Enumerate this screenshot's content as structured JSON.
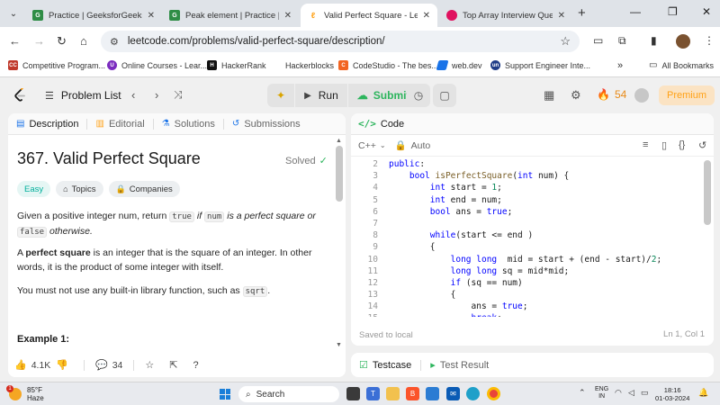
{
  "browser": {
    "tabs": [
      {
        "title": "Practice | GeeksforGeeks | A",
        "favicon": "gfg-icon",
        "color": "#2f8d46"
      },
      {
        "title": "Peak element | Practice | Ge",
        "favicon": "gfg-icon",
        "color": "#2f8d46"
      },
      {
        "title": "Valid Perfect Square - LeetC",
        "favicon": "leetcode-icon",
        "color": "#ffa116"
      },
      {
        "title": "Top Array Interview Questio",
        "favicon": "scaler-icon",
        "color": "#e0115f"
      }
    ],
    "url": "leetcode.com/problems/valid-perfect-square/description/",
    "bookmarks": [
      {
        "label": "Competitive Program...",
        "color": "#c0392b",
        "glyph": "CC"
      },
      {
        "label": "Online Courses - Lear...",
        "color": "#7b2cbf",
        "glyph": "U"
      },
      {
        "label": "HackerRank",
        "color": "#111111",
        "glyph": "H"
      },
      {
        "label": "Hackerblocks",
        "color": "#ffffff",
        "glyph": ""
      },
      {
        "label": "CodeStudio - The bes...",
        "color": "#f26522",
        "glyph": "C"
      },
      {
        "label": "web.dev",
        "color": "#1a73e8",
        "glyph": ""
      },
      {
        "label": "Support Engineer Inte...",
        "color": "#1f3c88",
        "glyph": "un"
      }
    ],
    "all_bookmarks": "All Bookmarks"
  },
  "header": {
    "problem_list": "Problem List",
    "run": "Run",
    "submit": "Submit",
    "streak": "54",
    "premium": "Premium"
  },
  "left": {
    "tabs": [
      "Description",
      "Editorial",
      "Solutions",
      "Submissions"
    ],
    "title": "367. Valid Perfect Square",
    "status": "Solved",
    "chips": [
      "Easy",
      "Topics",
      "Companies"
    ],
    "p1": {
      "a": "Given a positive integer num, return ",
      "c1": "true",
      "b": " if ",
      "c2": "num",
      "d": " is a perfect square or ",
      "c3": "false",
      "e": " otherwise."
    },
    "p2": {
      "bold": "perfect square",
      "a": "A ",
      "b": " is an integer that is the square of an integer. In other words, it is the product of some integer with itself."
    },
    "p3": {
      "a": "You must not use any built-in library function, such as ",
      "code": "sqrt",
      "b": "."
    },
    "example": "Example 1:",
    "likes": "4.1K",
    "comments": "34"
  },
  "code": {
    "title": "Code",
    "language": "C++",
    "auto": "Auto",
    "lines": [
      {
        "n": "2",
        "t": "public:"
      },
      {
        "n": "3",
        "t": "    bool isPerfectSquare(int num) {"
      },
      {
        "n": "4",
        "t": "        int start = 1;"
      },
      {
        "n": "5",
        "t": "        int end = num;"
      },
      {
        "n": "6",
        "t": "        bool ans = true;"
      },
      {
        "n": "7",
        "t": ""
      },
      {
        "n": "8",
        "t": "        while(start <= end )"
      },
      {
        "n": "9",
        "t": "        {"
      },
      {
        "n": "10",
        "t": "            long long  mid = start + (end - start)/2;"
      },
      {
        "n": "11",
        "t": "            long long sq = mid*mid;"
      },
      {
        "n": "12",
        "t": "            if (sq == num)"
      },
      {
        "n": "13",
        "t": "            {"
      },
      {
        "n": "14",
        "t": "                ans = true;"
      },
      {
        "n": "15",
        "t": "                break;"
      }
    ],
    "saved": "Saved to local",
    "cursor": "Ln 1, Col 1"
  },
  "test": {
    "testcase": "Testcase",
    "result": "Test Result"
  },
  "taskbar": {
    "temp": "85°F",
    "weather": "Haze",
    "badge": "1",
    "search": "Search",
    "lang1": "ENG",
    "lang2": "IN",
    "time": "18:16",
    "date": "01-03-2024"
  }
}
